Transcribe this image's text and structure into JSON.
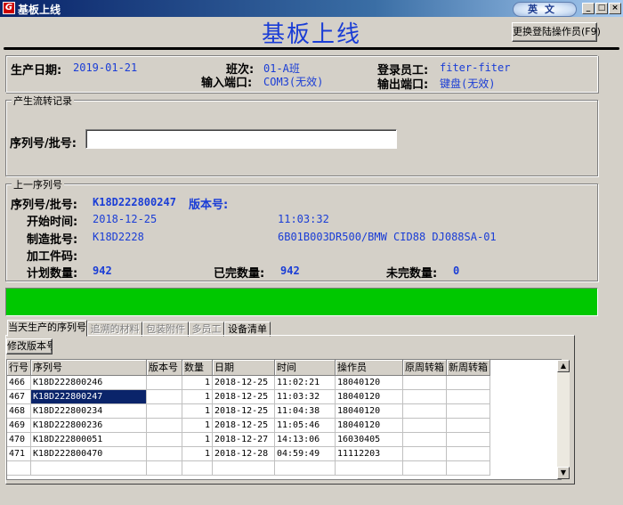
{
  "window": {
    "title": "基板上线",
    "lang_badge": "英文",
    "minimize": "_",
    "maximize": "□",
    "close": "×"
  },
  "header": {
    "title": "基板上线",
    "switch_operator_button": "更换登陆操作员(F9)"
  },
  "info": {
    "production_date_label": "生产日期:",
    "production_date": "2019-01-21",
    "shift_label": "班次:",
    "shift": "01-A班",
    "input_port_label": "输入端口:",
    "input_port": "COM3(无效)",
    "login_employee_label": "登录员工:",
    "login_employee": "fiter-fiter",
    "output_port_label": "输出端口:",
    "output_port": "键盘(无效)"
  },
  "flow": {
    "group_label": "产生流转记录",
    "serial_label": "序列号/批号:",
    "serial_value": ""
  },
  "prev": {
    "group_label": "上一序列号",
    "serial_label": "序列号/批号:",
    "serial": "K18D222800247",
    "version_label": "版本号:",
    "version": "",
    "start_time_label": "开始时间:",
    "start_date": "2018-12-25",
    "start_time": "11:03:32",
    "mfg_batch_label": "制造批号:",
    "mfg_batch": "K18D2228",
    "model": "6B01B003DR500/BMW CID88 DJ088SA-01",
    "part_code_label": "加工件码:",
    "part_code": "",
    "plan_qty_label": "计划数量:",
    "plan_qty": "942",
    "done_qty_label": "已完数量:",
    "done_qty": "942",
    "undone_qty_label": "未完数量:",
    "undone_qty": "0"
  },
  "tabs": [
    {
      "label": "当天生产的序列号",
      "active": true,
      "disabled": false
    },
    {
      "label": "追溯的材料",
      "active": false,
      "disabled": true
    },
    {
      "label": "包装附件",
      "active": false,
      "disabled": true
    },
    {
      "label": "多员工",
      "active": false,
      "disabled": true
    },
    {
      "label": "设备清单",
      "active": false,
      "disabled": false
    }
  ],
  "modify_version_button": "修改版本号",
  "grid": {
    "columns": [
      "行号",
      "序列号",
      "版本号",
      "数量",
      "日期",
      "时间",
      "操作员",
      "原周转箱",
      "新周转箱"
    ],
    "rows": [
      {
        "line": "466",
        "serial": "K18D222800246",
        "version": "",
        "qty": "1",
        "date": "2018-12-25",
        "time": "11:02:21",
        "operator": "18040120",
        "old_box": "",
        "new_box": ""
      },
      {
        "line": "467",
        "serial": "K18D222800247",
        "version": "",
        "qty": "1",
        "date": "2018-12-25",
        "time": "11:03:32",
        "operator": "18040120",
        "old_box": "",
        "new_box": "",
        "selected": true
      },
      {
        "line": "468",
        "serial": "K18D222800234",
        "version": "",
        "qty": "1",
        "date": "2018-12-25",
        "time": "11:04:38",
        "operator": "18040120",
        "old_box": "",
        "new_box": ""
      },
      {
        "line": "469",
        "serial": "K18D222800236",
        "version": "",
        "qty": "1",
        "date": "2018-12-25",
        "time": "11:05:46",
        "operator": "18040120",
        "old_box": "",
        "new_box": ""
      },
      {
        "line": "470",
        "serial": "K18D222800051",
        "version": "",
        "qty": "1",
        "date": "2018-12-27",
        "time": "14:13:06",
        "operator": "16030405",
        "old_box": "",
        "new_box": ""
      },
      {
        "line": "471",
        "serial": "K18D222800470",
        "version": "",
        "qty": "1",
        "date": "2018-12-28",
        "time": "04:59:49",
        "operator": "11112203",
        "old_box": "",
        "new_box": ""
      }
    ]
  },
  "colors": {
    "accent_blue": "#1a3dd6",
    "status_green": "#00c800",
    "selection": "#0a246a"
  }
}
